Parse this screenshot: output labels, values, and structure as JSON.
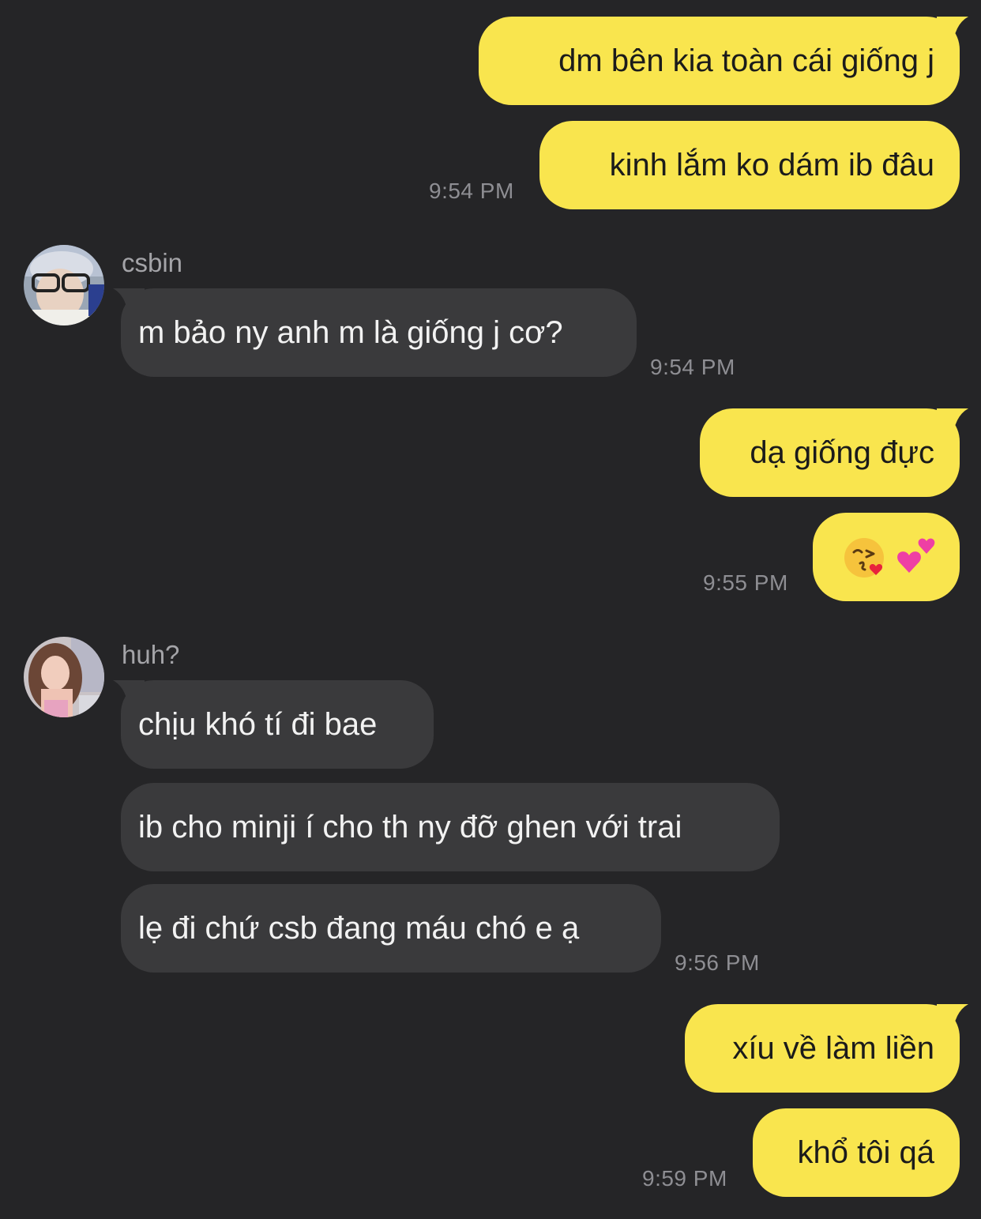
{
  "messages": {
    "m1": "dm bên kia toàn cái giống j",
    "m2": "kinh lắm ko dám ib đâu",
    "t1": "9:54 PM",
    "sender1": "csbin",
    "m3": "m bảo ny anh m là giống j cơ?",
    "t2": "9:54 PM",
    "m4": "dạ giống đực",
    "m5_emojis": [
      "kissing-face-with-heart",
      "two-hearts"
    ],
    "t3": "9:55 PM",
    "sender2": "huh?",
    "m6": "chịu khó tí đi bae",
    "m7": "ib cho minji í cho th ny đỡ ghen với trai",
    "m8": "lẹ đi chứ csb đang máu chó e ạ",
    "t4": "9:56 PM",
    "m9": "xíu về làm liền",
    "m10": "khổ tôi qá",
    "t5": "9:59 PM"
  },
  "colors": {
    "background": "#252527",
    "outgoing_bubble": "#f9e54e",
    "incoming_bubble": "#3a3a3c",
    "timestamp": "#8e8e93"
  }
}
